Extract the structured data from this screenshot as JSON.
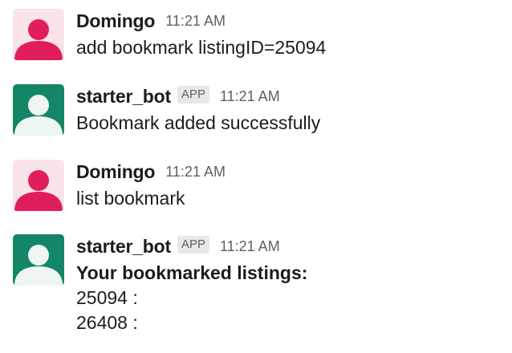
{
  "colors": {
    "user_avatar_bg": "#fbe3ea",
    "user_avatar_fg": "#e01e5a",
    "bot_avatar_bg": "#148567",
    "bot_avatar_fg": "#eef5f3"
  },
  "messages": [
    {
      "sender": "Domingo",
      "timestamp": "11:21 AM",
      "lines": [
        "add bookmark listingID=25094"
      ]
    },
    {
      "sender": "starter_bot",
      "badge": "APP",
      "timestamp": "11:21 AM",
      "lines": [
        "Bookmark added successfully"
      ]
    },
    {
      "sender": "Domingo",
      "timestamp": "11:21 AM",
      "lines": [
        "list bookmark"
      ]
    },
    {
      "sender": "starter_bot",
      "badge": "APP",
      "timestamp": "11:21 AM",
      "lines": [
        "Your bookmarked listings:",
        "25094 :",
        "26408 :"
      ]
    }
  ]
}
